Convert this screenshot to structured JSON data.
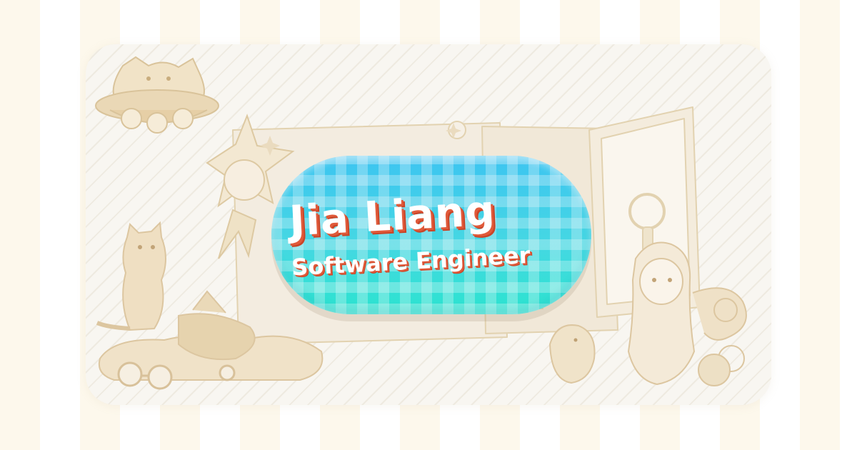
{
  "profile": {
    "name": "Jia Liang",
    "title": "Software Engineer"
  },
  "colors": {
    "stripe_cream": "#fdf8ec",
    "card_background": "#f8f6f1",
    "line_art": "#e9dcc2",
    "badge_cyan": "#3fcaf3",
    "badge_teal": "#2fe6d2",
    "text_white": "#ffffff",
    "text_shadow_red": "#e05a3a"
  },
  "decorations": [
    "ufo-cat-icon",
    "star-character-icon",
    "sparkle-icon",
    "cat-icon",
    "plush-pile-icon",
    "goggles-icon",
    "canvas-frame-icon",
    "mirror-frame-icon",
    "bird-icon",
    "girl-character-icon"
  ]
}
